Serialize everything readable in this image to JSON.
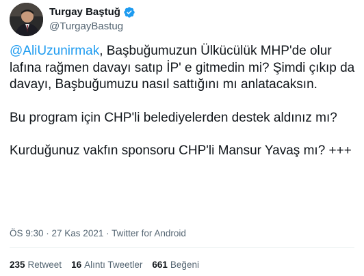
{
  "author": {
    "display_name": "Turgay Baştuğ",
    "handle": "@TurgayBastug",
    "verified": true
  },
  "tweet": {
    "paragraphs": [
      {
        "mention": "@AliUzunirmak",
        "text": ", Başbuğumuzun Ülkücülük MHP'de olur lafına rağmen davayı satıp İP' e gitmedin mi? Şimdi çıkıp da davayı, Başbuğumuzu nasıl sattığını mı anlatacaksın."
      },
      {
        "text": "Bu program için CHP'li belediyelerden destek aldınız mı?"
      },
      {
        "text": "Kurduğunuz vakfın sponsoru CHP'li Mansur Yavaş mı? +++"
      }
    ],
    "timestamp": "ÖS 9:30 · 27 Kas 2021 ·",
    "source": "Twitter for Android"
  },
  "stats": {
    "retweets_count": "235",
    "retweets_label": "Retweet",
    "quotes_count": "16",
    "quotes_label": "Alıntı Tweetler",
    "likes_count": "661",
    "likes_label": "Beğeni"
  },
  "colors": {
    "link": "#1d9bf0",
    "text": "#0f1419",
    "secondary": "#536471",
    "verified": "#1d9bf0"
  }
}
